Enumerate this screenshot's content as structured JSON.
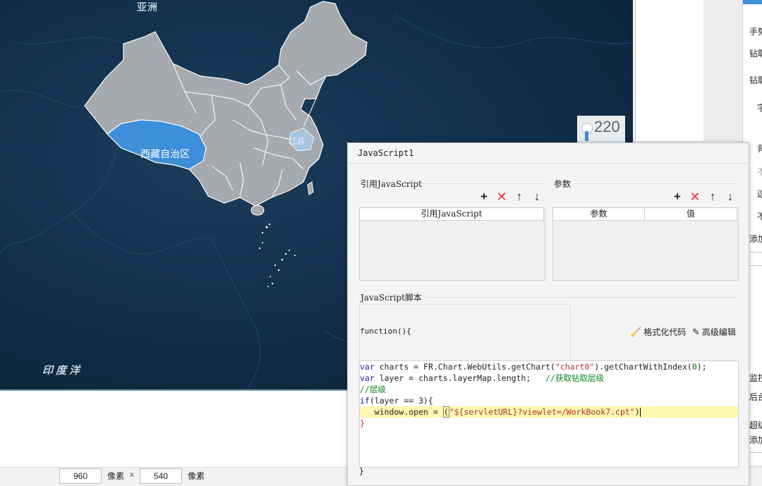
{
  "map": {
    "asia_label": "亚洲",
    "ocean_label": "印度洋",
    "highlight_region": "西藏自治区",
    "small_region": "江苏",
    "range_value": "220"
  },
  "size_bar": {
    "width": "960",
    "width_unit": "像素",
    "x_sep": "x",
    "height": "540",
    "height_unit": "像素"
  },
  "right_panel": {
    "rows": [
      "手势",
      "钻取",
      "钻取",
      "字",
      "背",
      "不",
      "这",
      "不",
      "添加",
      "监控",
      "后台",
      "超级",
      "添加"
    ]
  },
  "dialog": {
    "title": "JavaScript1",
    "ref_section": "引用JavaScript",
    "param_section": "参数",
    "ref_header": "引用JavaScript",
    "param_header": "参数",
    "value_header": "值",
    "script_section": "JavaScript脚本",
    "fn_signature": "function(){",
    "format_code": "格式化代码",
    "advanced_edit": "高级编辑",
    "code": {
      "l1_kw": "var",
      "l1_a": " charts = FR.Chart.WebUtils.getChart(",
      "l1_str": "\"chart0\"",
      "l1_b": ").getChartWithIndex(",
      "l1_num": "0",
      "l1_c": ");",
      "l2_kw": "var",
      "l2_a": " layer = charts.layerMap.length;   ",
      "l2_cm": "//获取钻取层级",
      "l3_cm": "//层级",
      "l4_kw": "if",
      "l4_a": "(layer == 3){",
      "l5_a": "   window.open = ",
      "l5_str": "\"${servletURL}?viewlet=/WorkBook7.cpt\"",
      "l5_b": ")",
      "l6": "}"
    },
    "closing_brace": "}"
  },
  "colors": {
    "map_bg": "#12304c",
    "province_fill": "#a6a9ad",
    "highlight_fill": "#3c8fd8",
    "accent": "#3c8fd8"
  }
}
